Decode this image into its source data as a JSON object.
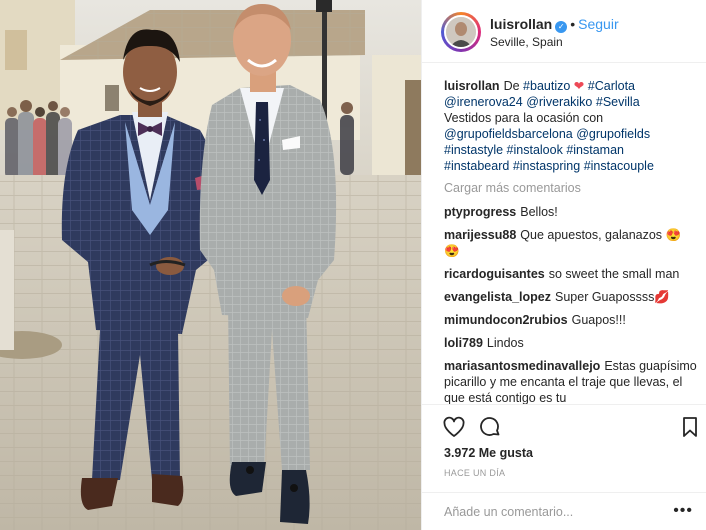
{
  "post": {
    "username": "luisrollan",
    "follow_label": "Seguir",
    "location": "Seville, Spain",
    "caption": {
      "username": "luisrollan",
      "text_1": "De",
      "tag_bautizo": "#bautizo",
      "tag_carlota": "#Carlota",
      "mention_1": "@irenerova24",
      "mention_2": "@riverakiko",
      "tag_sevilla": "#Sevilla",
      "text_2": "Vestidos para la ocasión con",
      "mention_3": "@grupofieldsbarcelona",
      "mention_4": "@grupofields",
      "tag_instastyle": "#instastyle",
      "tag_instalook": "#instalook",
      "tag_instaman": "#instaman",
      "tag_instabeard": "#instabeard",
      "tag_instaspring": "#instaspring",
      "tag_instacouple": "#instacouple"
    },
    "load_more": "Cargar más comentarios",
    "comments": [
      {
        "user": "ptyprogress",
        "text": "Bellos!"
      },
      {
        "user": "marijessu88",
        "text": "Que apuestos, galanazos"
      },
      {
        "user": "ricardoguisantes",
        "text": "so sweet the small man"
      },
      {
        "user": "evangelista_lopez",
        "text": "Super Guapossss"
      },
      {
        "user": "mimundocon2rubios",
        "text": "Guapos!!!"
      },
      {
        "user": "loli789",
        "text": "Lindos"
      },
      {
        "user": "mariasantosmedinavallejo",
        "text": "Estas guapísimo picarillo y me encanta el traje que llevas, el que está contigo es tu"
      }
    ],
    "likes": "3.972 Me gusta",
    "time": "HACE UN DÍA",
    "add_comment_placeholder": "Añade un comentario...",
    "more_options": "•••"
  },
  "colors": {
    "link": "#003569",
    "follow": "#3897f0",
    "heart": "#ed4956",
    "muted": "#999999"
  },
  "icons": [
    "heart-icon",
    "comment-icon",
    "bookmark-icon",
    "verified-icon",
    "red-heart-emoji",
    "heart-eyes-emoji"
  ]
}
